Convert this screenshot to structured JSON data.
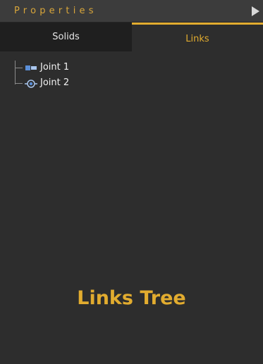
{
  "header": {
    "title": "Properties",
    "collapse_icon": "triangle-right-icon"
  },
  "tabs": [
    {
      "label": "Solids",
      "active": false
    },
    {
      "label": "Links",
      "active": true
    }
  ],
  "tree": {
    "items": [
      {
        "label": "Joint 1",
        "icon": "prismatic-joint-icon"
      },
      {
        "label": "Joint 2",
        "icon": "revolute-joint-icon"
      }
    ]
  },
  "footer": {
    "title": "Links Tree"
  },
  "colors": {
    "accent": "#e2ac2f",
    "header_bg": "#3c3c3c",
    "panel_bg": "#2d2d2d",
    "inactive_tab_bg": "#1f1f1f",
    "joint_icon_blue": "#5b8fd8"
  }
}
